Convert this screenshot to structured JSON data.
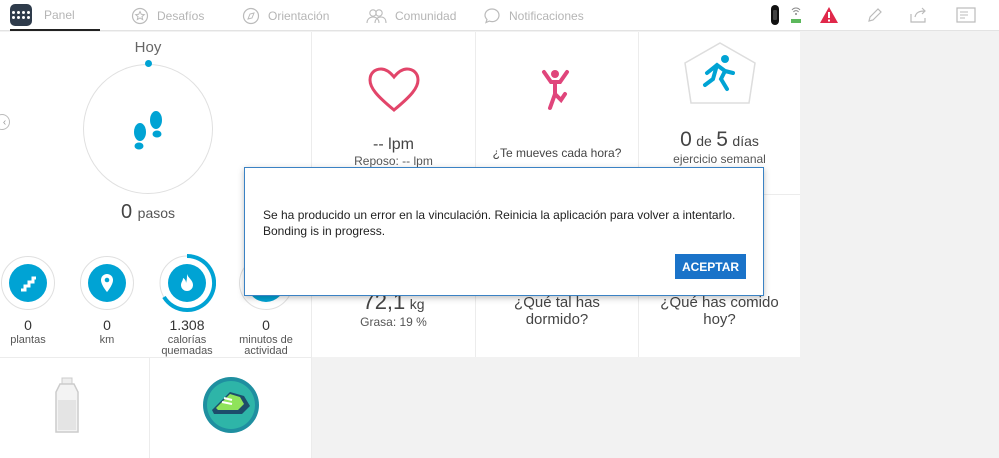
{
  "nav": {
    "tabs": [
      {
        "label": "Panel",
        "icon": "grid-logo-icon"
      },
      {
        "label": "Desafíos",
        "icon": "star-badge-icon"
      },
      {
        "label": "Orientación",
        "icon": "compass-icon"
      },
      {
        "label": "Comunidad",
        "icon": "people-icon"
      },
      {
        "label": "Notificaciones",
        "icon": "chat-bubble-icon"
      }
    ],
    "right_icons": [
      "tracker-battery-icon",
      "sync-status-icon",
      "alert-icon",
      "edit-pencil-icon",
      "share-icon",
      "account-card-icon"
    ]
  },
  "today": {
    "title": "Hoy",
    "steps_value": "0",
    "steps_unit": "pasos"
  },
  "stats": [
    {
      "value": "0",
      "label": "plantas",
      "icon": "stairs-icon"
    },
    {
      "value": "0",
      "label": "km",
      "icon": "location-pin-icon"
    },
    {
      "value": "1.308",
      "label": "calorías quemadas",
      "icon": "flame-icon"
    },
    {
      "value": "0",
      "label": "minutos de actividad",
      "icon": "lightning-icon"
    }
  ],
  "heart": {
    "value": "-- lpm",
    "rest": "Reposo: -- lpm"
  },
  "hourly": {
    "label": "¿Te mueves cada hora?"
  },
  "exercise": {
    "count": "0",
    "of": "de",
    "goal": "5",
    "unit": "días",
    "label": "ejercicio semanal"
  },
  "weight": {
    "value": "72,1",
    "unit": "kg",
    "fat": "Grasa: 19 %"
  },
  "sleep": {
    "label": "¿Qué tal has dormido?"
  },
  "food": {
    "label": "¿Qué has comido hoy?"
  },
  "dialog": {
    "message": "Se ha producido un error en la vinculación. Reinicia la aplicación para volver a intentarlo. Bonding is in progress.",
    "button": "ACEPTAR"
  },
  "colors": {
    "accent": "#00a3d4",
    "heart": "#e2456a",
    "pink": "#e0457b",
    "button": "#1a73c9",
    "alert": "#e0284a"
  }
}
